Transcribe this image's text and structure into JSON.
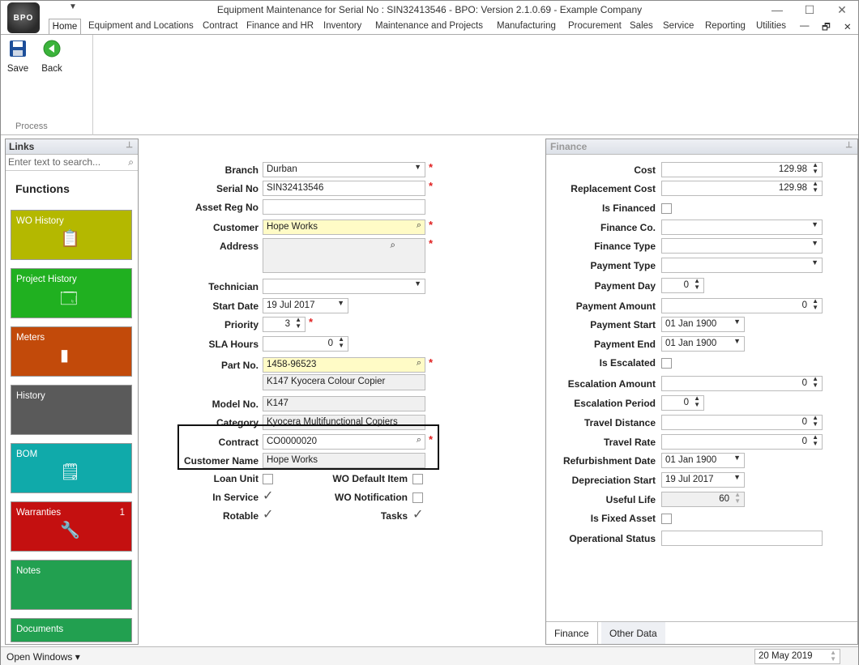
{
  "app": {
    "logo_text": "BPO",
    "title": "Equipment Maintenance for Serial No : SIN32413546 - BPO: Version 2.1.0.69 - Example Company"
  },
  "menu": [
    "Equipment and Locations",
    "Contract",
    "Finance and HR",
    "Inventory",
    "Maintenance and Projects",
    "Manufacturing",
    "Procurement",
    "Sales",
    "Service",
    "Reporting",
    "Utilities"
  ],
  "home_tab": "Home",
  "ribbon": {
    "save": "Save",
    "back": "Back",
    "group": "Process"
  },
  "links": {
    "title": "Links",
    "search_placeholder": "Enter text to search...",
    "functions_title": "Functions",
    "tiles": [
      {
        "label": "WO History",
        "color": "#b4b800"
      },
      {
        "label": "Project History",
        "color": "#20b020"
      },
      {
        "label": "Meters",
        "color": "#c24a0a"
      },
      {
        "label": "History",
        "color": "#5a5a5a"
      },
      {
        "label": "BOM",
        "color": "#10aaaa"
      },
      {
        "label": "Warranties",
        "color": "#c41010",
        "badge": "1"
      },
      {
        "label": "Notes",
        "color": "#22a050"
      },
      {
        "label": "Documents",
        "color": "#22a050"
      }
    ]
  },
  "form": {
    "branch": {
      "label": "Branch",
      "value": "Durban"
    },
    "serial_no": {
      "label": "Serial No",
      "value": "SIN32413546"
    },
    "asset_reg_no": {
      "label": "Asset Reg No",
      "value": ""
    },
    "customer": {
      "label": "Customer",
      "value": "Hope Works"
    },
    "address": {
      "label": "Address",
      "value": ""
    },
    "technician": {
      "label": "Technician",
      "value": ""
    },
    "start_date": {
      "label": "Start Date",
      "value": "19 Jul 2017"
    },
    "priority": {
      "label": "Priority",
      "value": "3"
    },
    "sla_hours": {
      "label": "SLA Hours",
      "value": "0"
    },
    "part_no": {
      "label": "Part No.",
      "value": "1458-96523"
    },
    "part_desc": "K147 Kyocera Colour Copier",
    "model_no": {
      "label": "Model No.",
      "value": "K147"
    },
    "category": {
      "label": "Category",
      "value": "Kyocera Multifunctional Copiers"
    },
    "contract": {
      "label": "Contract",
      "value": "CO0000020"
    },
    "customer_name": {
      "label": "Customer Name",
      "value": "Hope Works"
    },
    "loan_unit": {
      "label": "Loan Unit",
      "checked": false
    },
    "in_service": {
      "label": "In Service",
      "checked": true
    },
    "rotable": {
      "label": "Rotable",
      "checked": true
    },
    "wo_default_item": {
      "label": "WO Default Item",
      "checked": false
    },
    "wo_notification": {
      "label": "WO Notification",
      "checked": false
    },
    "tasks": {
      "label": "Tasks",
      "checked": true
    }
  },
  "finance": {
    "title": "Finance",
    "cost": {
      "label": "Cost",
      "value": "129.98"
    },
    "replacement_cost": {
      "label": "Replacement Cost",
      "value": "129.98"
    },
    "is_financed": {
      "label": "Is Financed",
      "checked": false
    },
    "finance_co": {
      "label": "Finance Co.",
      "value": ""
    },
    "finance_type": {
      "label": "Finance Type",
      "value": ""
    },
    "payment_type": {
      "label": "Payment Type",
      "value": ""
    },
    "payment_day": {
      "label": "Payment Day",
      "value": "0"
    },
    "payment_amount": {
      "label": "Payment Amount",
      "value": "0"
    },
    "payment_start": {
      "label": "Payment Start",
      "value": "01 Jan 1900"
    },
    "payment_end": {
      "label": "Payment End",
      "value": "01 Jan 1900"
    },
    "is_escalated": {
      "label": "Is Escalated",
      "checked": false
    },
    "escalation_amount": {
      "label": "Escalation Amount",
      "value": "0"
    },
    "escalation_period": {
      "label": "Escalation Period",
      "value": "0"
    },
    "travel_distance": {
      "label": "Travel Distance",
      "value": "0"
    },
    "travel_rate": {
      "label": "Travel Rate",
      "value": "0"
    },
    "refurbishment_date": {
      "label": "Refurbishment Date",
      "value": "01 Jan 1900"
    },
    "depreciation_start": {
      "label": "Depreciation Start",
      "value": "19 Jul 2017"
    },
    "useful_life": {
      "label": "Useful Life",
      "value": "60"
    },
    "is_fixed_asset": {
      "label": "Is Fixed Asset",
      "checked": false
    },
    "operational_status": {
      "label": "Operational Status",
      "value": ""
    },
    "tabs": [
      "Finance",
      "Other Data"
    ]
  },
  "status": {
    "open_windows": "Open Windows",
    "date": "20 May 2019"
  }
}
